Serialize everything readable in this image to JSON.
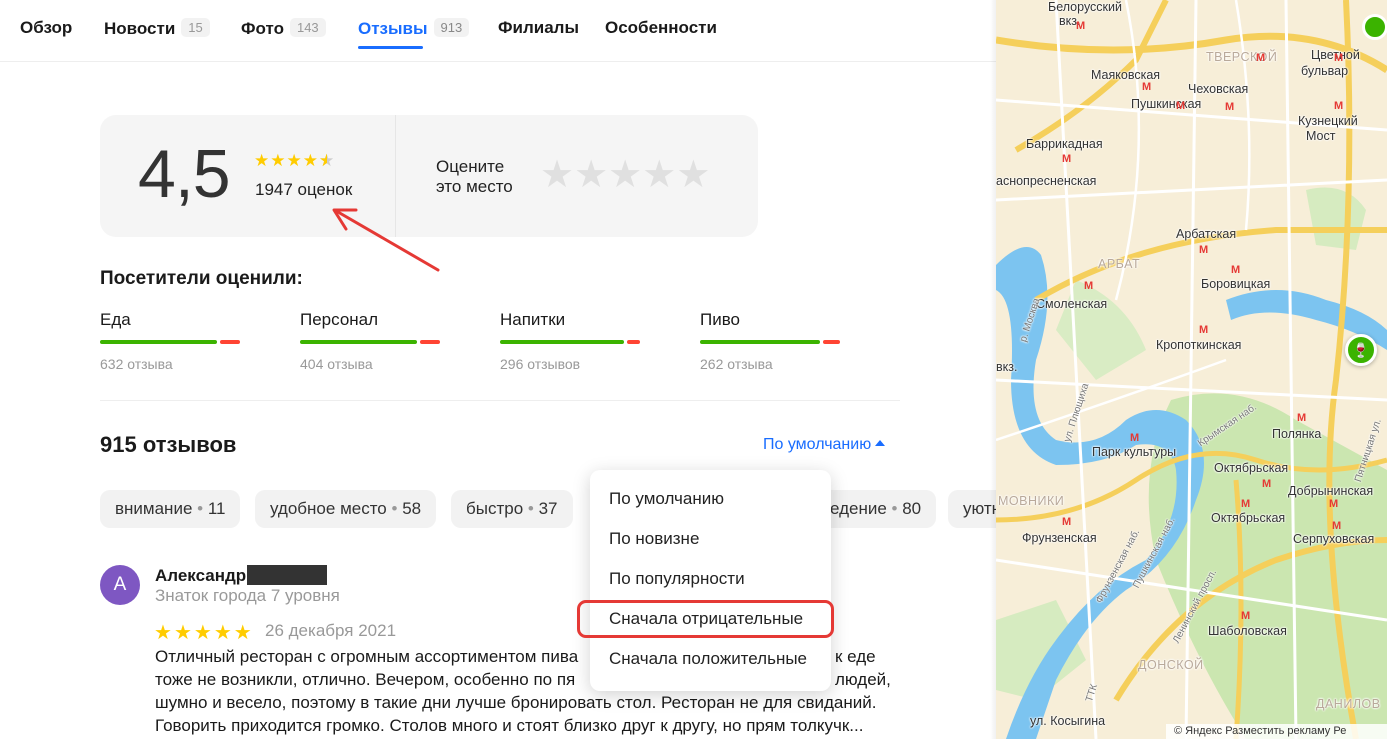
{
  "tabs": [
    {
      "label": "Обзор",
      "count": ""
    },
    {
      "label": "Новости",
      "count": "15"
    },
    {
      "label": "Фото",
      "count": "143"
    },
    {
      "label": "Отзывы",
      "count": "913"
    },
    {
      "label": "Филиалы",
      "count": ""
    },
    {
      "label": "Особенности",
      "count": ""
    }
  ],
  "rating": {
    "value": "4,5",
    "stars_value": 4.5,
    "count_label": "1947 оценок",
    "rate_prompt_line1": "Оцените",
    "rate_prompt_line2": "это место"
  },
  "criteria": {
    "title": "Посетители оценили:",
    "items": [
      {
        "name": "Еда",
        "reviews": "632 отзыва",
        "positive_share": 0.86
      },
      {
        "name": "Персонал",
        "reviews": "404 отзыва",
        "positive_share": 0.86
      },
      {
        "name": "Напитки",
        "reviews": "296 отзывов",
        "positive_share": 0.91
      },
      {
        "name": "Пиво",
        "reviews": "262 отзыва",
        "positive_share": 0.88
      }
    ]
  },
  "reviews": {
    "count_label": "915 отзывов",
    "sort_label": "По умолчанию"
  },
  "chips": [
    {
      "label": "внимание",
      "count": "11"
    },
    {
      "label": "удобное место",
      "count": "58"
    },
    {
      "label": "быстро",
      "count": "37"
    },
    {
      "label": "едение",
      "count": "80"
    },
    {
      "label": "уютн",
      "count": ""
    }
  ],
  "sort_menu": {
    "options": [
      "По умолчанию",
      "По новизне",
      "По популярности",
      "Сначала отрицательные",
      "Сначала положительные"
    ],
    "highlighted": "Сначала отрицательные"
  },
  "review": {
    "avatar_letter": "А",
    "author": "Александр",
    "level": "Знаток города 7 уровня",
    "stars": 5,
    "date": "26 декабря 2021",
    "text": "Отличный ресторан с огромным ассортиментом пива … к еде тоже не возникли, отлично. Вечером, особенно по пя… людей, шумно и весело, поэтому в такие дни лучше бронировать стол. Ресторан не для свиданий. Говорить приходится громко. Столов много и стоят близко друг к другу, но прям толкучк…",
    "line1": "Отличный ресторан с огромным ассортиментом пива",
    "line1_end": "к еде",
    "line2": "тоже не возникли, отлично. Вечером, особенно по пя",
    "line2_end": "людей,",
    "line3": "шумно и весело, поэтому в такие дни лучше бронировать стол. Ресторан не для свиданий.",
    "line4": "Говорить приходится громко. Столов много и стоят близко друг к другу, но прям толкучк..."
  },
  "map": {
    "labels": {
      "belorussky": "Белорусский",
      "vkz": "вкз.",
      "tverskoy": "ТВЕРСКОЙ",
      "tsvetnoy1": "Цветной",
      "tsvetnoy2": "бульвар",
      "mayakovskaya": "Маяковская",
      "chekhovskaya": "Чеховская",
      "pushkinskaya": "Пушкинская",
      "kuznetsky1": "Кузнецкий",
      "kuznetsky2": "Мост",
      "barrikadnaya": "Баррикадная",
      "krasnopresnenskaya": "аснопресненская",
      "arbatskaya": "Арбатская",
      "arbat": "АРБАТ",
      "borovitskaya": "Боровицкая",
      "smolenskaya": "Смоленская",
      "kropotkinskaya": "Кропоткинская",
      "moskva_river": "р. Москва",
      "vkz2": "вкз.",
      "plyushchikha": "ул. Плющиха",
      "krymsky": "Крымская наб.",
      "pyatnitskaya": "Пятницкая ул.",
      "park_kultury": "Парк культуры",
      "polyanka": "Полянка",
      "oktyabrskaya": "Октябрьская",
      "dobryninskaya": "Добрынинская",
      "khamovniki": "МОВНИКИ",
      "frunzenskaya": "Фрунзенская",
      "oktyabrskaya2": "Октябрьская",
      "serpukhovskaya": "Серпуховская",
      "frunzenskaya_nab": "Фрунзенская наб.",
      "pushkinskaya_nab": "Пушкинская наб.",
      "leninsky": "Ленинский просп.",
      "shabolovskaya": "Шаболовская",
      "donskoy": "ДОНСКОЙ",
      "ttk": "ТТК",
      "kosygina": "ул. Косыгина",
      "danilovsky": "ДАНИЛОВ"
    },
    "footer": "© Яндекс   Разместить рекламу   Ре"
  },
  "colors": {
    "accent": "#196dff",
    "star": "#ffcc00",
    "positive": "#3bb300",
    "negative": "#ff4433",
    "annotation": "#e53935"
  }
}
